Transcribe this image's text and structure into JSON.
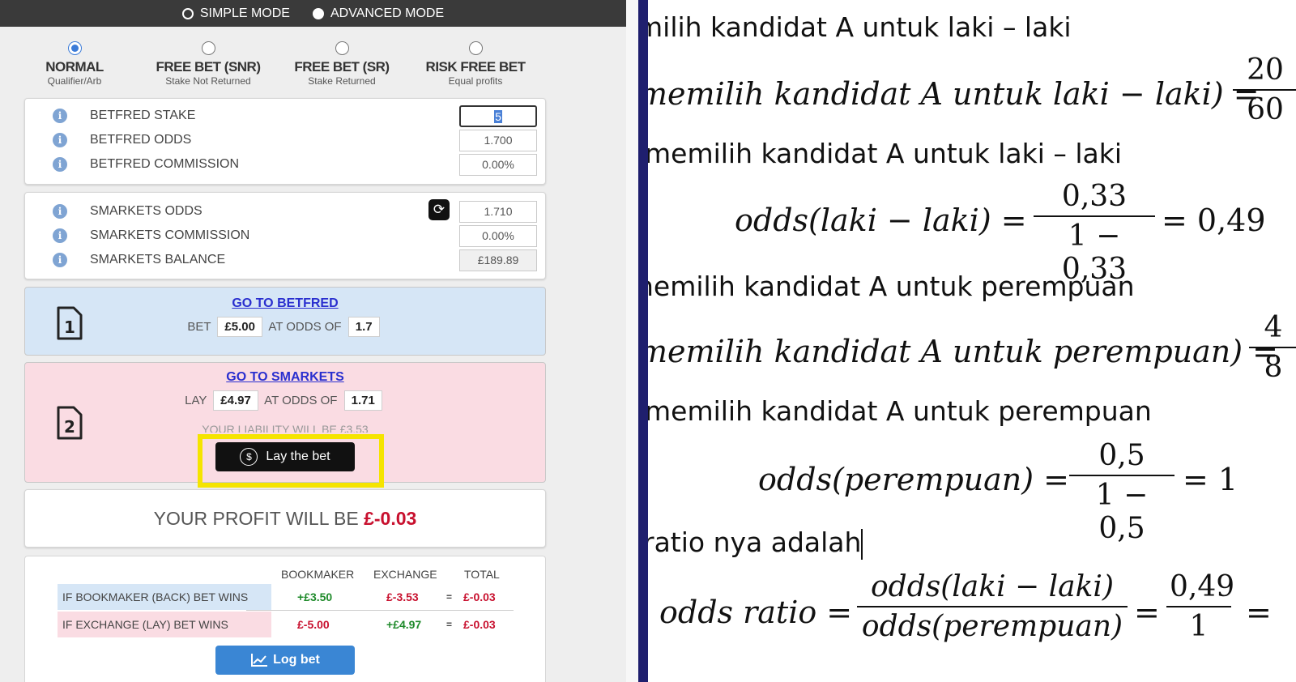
{
  "mode": {
    "simple": "SIMPLE MODE",
    "advanced": "ADVANCED MODE",
    "selected": "simple"
  },
  "bet_types": [
    {
      "name": "NORMAL",
      "sub": "Qualifier/Arb",
      "selected": true
    },
    {
      "name": "FREE BET (SNR)",
      "sub": "Stake Not Returned",
      "selected": false
    },
    {
      "name": "FREE BET (SR)",
      "sub": "Stake Returned",
      "selected": false
    },
    {
      "name": "RISK FREE BET",
      "sub": "Equal profits",
      "selected": false
    }
  ],
  "bookmaker": {
    "stake_label": "BETFRED STAKE",
    "stake_value": "5",
    "odds_label": "BETFRED ODDS",
    "odds_value": "1.700",
    "commission_label": "BETFRED COMMISSION",
    "commission_value": "0.00%"
  },
  "exchange": {
    "odds_label": "SMARKETS ODDS",
    "odds_value": "1.710",
    "commission_label": "SMARKETS COMMISSION",
    "commission_value": "0.00%",
    "balance_label": "SMARKETS BALANCE",
    "balance_value": "£189.89"
  },
  "step1": {
    "link": "GO TO BETFRED",
    "bet": "BET",
    "amount": "£5.00",
    "at_odds": "AT ODDS OF",
    "odds": "1.7",
    "num": "1"
  },
  "step2": {
    "link": "GO TO SMARKETS",
    "lay": "LAY",
    "amount": "£4.97",
    "at_odds": "AT ODDS OF",
    "odds": "1.71",
    "num": "2",
    "liability": "YOUR LIABILITY WILL BE £3.53",
    "lay_button": "Lay the bet"
  },
  "profit": {
    "label": "YOUR PROFIT WILL BE",
    "value": "£-0.03"
  },
  "results": {
    "headers": [
      "BOOKMAKER",
      "EXCHANGE",
      "TOTAL"
    ],
    "rows": [
      {
        "label": "IF BOOKMAKER (BACK) BET WINS",
        "bookmaker": "+£3.50",
        "exchange": "£-3.53",
        "eq": "=",
        "total": "£-0.03"
      },
      {
        "label": "IF EXCHANGE (LAY) BET WINS",
        "bookmaker": "£-5.00",
        "exchange": "+£4.97",
        "eq": "=",
        "total": "£-0.03"
      }
    ],
    "log_button": "Log bet"
  },
  "document": {
    "line1": "milih kandidat A untuk laki – laki",
    "eq1_lhs": "memilih kandidat  A untuk laki − laki) =",
    "eq1_num": "20",
    "eq1_den": "60",
    "line2": "memilih kandidat A untuk laki – laki",
    "eq2_lhs": "odds(laki − laki) =",
    "eq2_num": "0,33",
    "eq2_den": "1 − 0,33",
    "eq2_res": "= 0,49",
    "line3": "nemilih kandidat A untuk perempuan",
    "eq3_lhs": "memilih kandidat  A untuk perempuan) =",
    "eq3_num": "4",
    "eq3_den": "8",
    "line4": "memilih kandidat A untuk perempuan",
    "eq4_lhs": "odds(perempuan) =",
    "eq4_num": "0,5",
    "eq4_den": "1 − 0,5",
    "eq4_res": "= 1",
    "line5": "ratio nya adalah",
    "eq5_lhs": "odds ratio =",
    "eq5_num": "odds(laki − laki)",
    "eq5_den": "odds(perempuan)",
    "eq5_eq": "=",
    "eq5_num2": "0,49",
    "eq5_den2": "1",
    "eq5_tail": "="
  }
}
